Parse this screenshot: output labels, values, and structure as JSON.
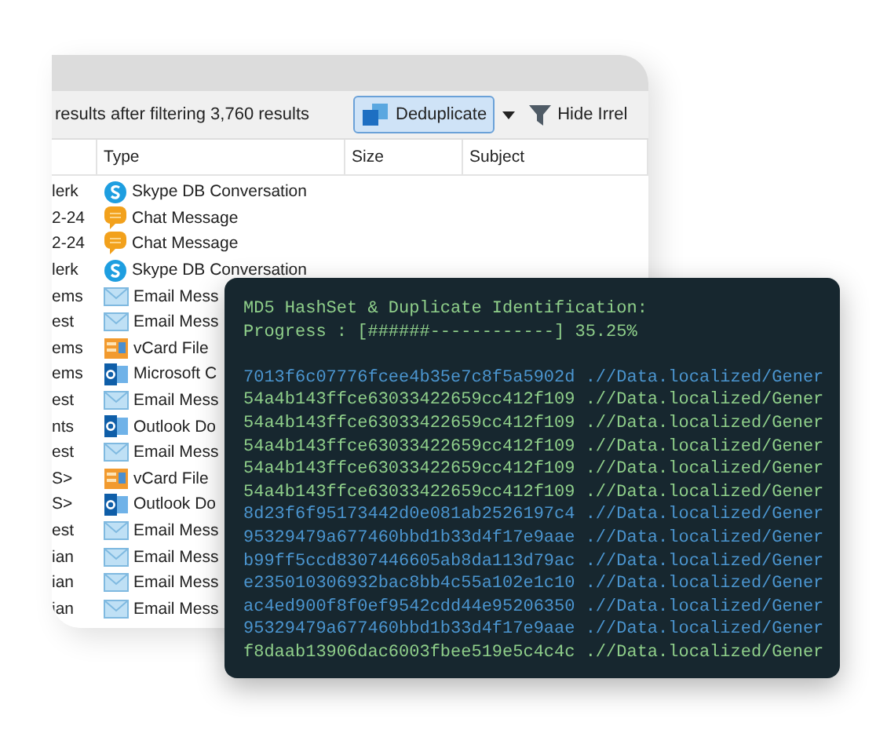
{
  "toolbar": {
    "result_summary": "results after filtering 3,760 results",
    "deduplicate_button": "Deduplicate",
    "hide_button": "Hide Irrel"
  },
  "table": {
    "columns": [
      "",
      "Type",
      "Size",
      "Subject"
    ],
    "rows": [
      {
        "column_1": "lerk",
        "type": "Skype DB Conversation",
        "kind": "skype"
      },
      {
        "column_1": "2-24",
        "type": "Chat Message",
        "kind": "chat"
      },
      {
        "column_1": "2-24",
        "type": "Chat Message",
        "kind": "chat"
      },
      {
        "column_1": "lerk",
        "type": "Skype DB Conversation",
        "kind": "skype"
      },
      {
        "column_1": "ems",
        "type": "Email Mess",
        "kind": "email"
      },
      {
        "column_1": "est",
        "type": "Email Mess",
        "kind": "email"
      },
      {
        "column_1": "ems",
        "type": "vCard File",
        "kind": "vcard"
      },
      {
        "column_1": "ems",
        "type": "Microsoft C",
        "kind": "outlook"
      },
      {
        "column_1": "est",
        "type": "Email Mess",
        "kind": "email"
      },
      {
        "column_1": "nts",
        "type": "Outlook Do",
        "kind": "outlook"
      },
      {
        "column_1": "est",
        "type": "Email Mess",
        "kind": "email"
      },
      {
        "column_1": "S>",
        "type": "vCard File",
        "kind": "vcard"
      },
      {
        "column_1": "S>",
        "type": "Outlook Do",
        "kind": "outlook"
      },
      {
        "column_1": "est",
        "type": "Email Mess",
        "kind": "email"
      },
      {
        "column_1": "ian",
        "type": "Email Mess",
        "kind": "email"
      },
      {
        "column_1": "ian",
        "type": "Email Mess",
        "kind": "email"
      },
      {
        "column_1": "ian",
        "type": "Email Mess",
        "kind": "email"
      }
    ]
  },
  "terminal": {
    "title": "MD5 HashSet & Duplicate Identification:",
    "progress": "Progress : [######------------] 35.25%",
    "lines": [
      {
        "hash": "7013f6c07776fcee4b35e7c8f5a5902d",
        "path": ".//Data.localized/Gener",
        "color": "#4b95cf"
      },
      {
        "hash": "54a4b143ffce63033422659cc412f109",
        "path": ".//Data.localized/Gener",
        "color": "#8fcf8a"
      },
      {
        "hash": "54a4b143ffce63033422659cc412f109",
        "path": ".//Data.localized/Gener",
        "color": "#8fcf8a"
      },
      {
        "hash": "54a4b143ffce63033422659cc412f109",
        "path": ".//Data.localized/Gener",
        "color": "#8fcf8a"
      },
      {
        "hash": "54a4b143ffce63033422659cc412f109",
        "path": ".//Data.localized/Gener",
        "color": "#8fcf8a"
      },
      {
        "hash": "54a4b143ffce63033422659cc412f109",
        "path": ".//Data.localized/Gener",
        "color": "#8fcf8a"
      },
      {
        "hash": "8d23f6f95173442d0e081ab2526197c4",
        "path": ".//Data.localized/Gener",
        "color": "#4b95cf"
      },
      {
        "hash": "95329479a677460bbd1b33d4f17e9aae",
        "path": ".//Data.localized/Gener",
        "color": "#4b95cf"
      },
      {
        "hash": "b99ff5ccd8307446605ab8da113d79ac",
        "path": ".//Data.localized/Gener",
        "color": "#4b95cf"
      },
      {
        "hash": "e235010306932bac8bb4c55a102e1c10",
        "path": ".//Data.localized/Gener",
        "color": "#4b95cf"
      },
      {
        "hash": "ac4ed900f8f0ef9542cdd44e95206350",
        "path": ".//Data.localized/Gener",
        "color": "#4b95cf"
      },
      {
        "hash": "95329479a677460bbd1b33d4f17e9aae",
        "path": ".//Data.localized/Gener",
        "color": "#4b95cf"
      },
      {
        "hash": "f8daab13906dac6003fbee519e5c4c4c",
        "path": ".//Data.localized/Gener",
        "color": "#8fcf8a"
      }
    ]
  }
}
